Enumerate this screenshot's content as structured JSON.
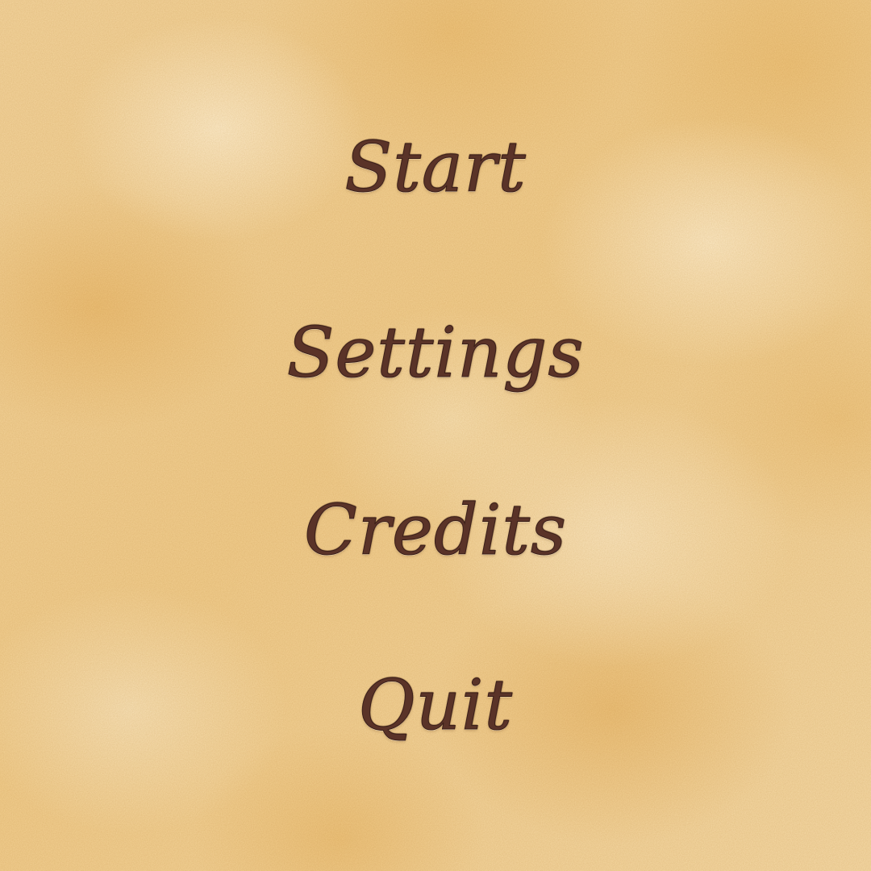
{
  "menu": {
    "items": [
      {
        "label": "Start"
      },
      {
        "label": "Settings"
      },
      {
        "label": "Credits"
      },
      {
        "label": "Quit"
      }
    ]
  },
  "colors": {
    "background": "#f0cf93",
    "text": "#4a2a22",
    "text_outline": "#3b1f18"
  }
}
